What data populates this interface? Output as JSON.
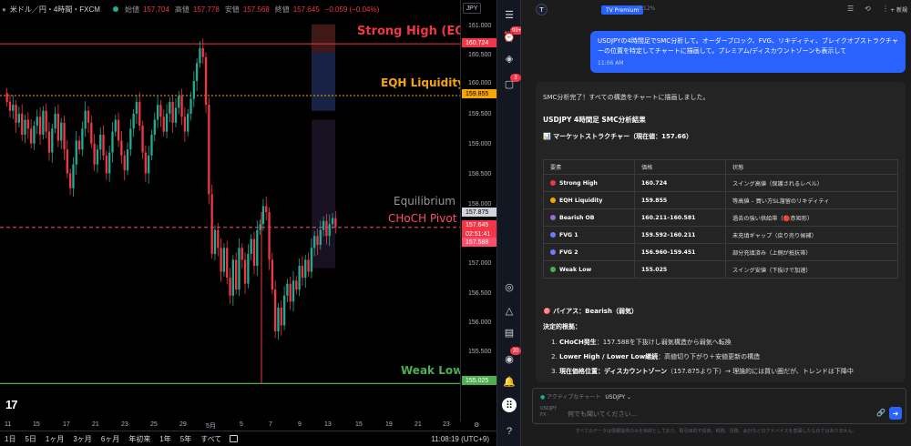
{
  "chart": {
    "symbol": "米ドル／円・4時間・FXCM",
    "ohlc": [
      {
        "label": "始値",
        "value": "157.704"
      },
      {
        "label": "高値",
        "value": "157.778"
      },
      {
        "label": "安値",
        "value": "157.568"
      },
      {
        "label": "終値",
        "value": "157.645"
      }
    ],
    "change": "−0.059 (−0.04%)",
    "currency": "JPY",
    "zones": {
      "strong_high": "Strong High (EQH)",
      "eqh_liquidity": "EQH Liquidity",
      "equilibrium": "Equilibrium",
      "choch_pivot": "CHoCH Pivot",
      "weak_low": "Weak Low"
    },
    "price_ticks": [
      "161.000",
      "160.500",
      "160.000",
      "159.500",
      "159.000",
      "158.500",
      "158.000",
      "157.000",
      "156.500",
      "156.000",
      "155.500"
    ],
    "price_tags": {
      "strong_high": "160.724",
      "eqh": "159.855",
      "equilibrium": "157.875",
      "current": "157.645",
      "countdown": "02:51:41",
      "choch": "157.588",
      "weak_low": "155.025"
    },
    "time_ticks": [
      "11",
      "15",
      "17",
      "21",
      "23",
      "25",
      "29",
      "5月",
      "5",
      "7",
      "9",
      "13",
      "15",
      "19",
      "21",
      "23"
    ],
    "colors": {
      "bull": "#22ab94",
      "bear": "#f23645",
      "strong_high": "#f23645",
      "eqh": "#f7a600",
      "equilibrium": "#9598a1",
      "choch": "#ff4d6d",
      "weak_low": "#4caf50"
    },
    "logo": "17"
  },
  "bottom_bar": {
    "timeframes": [
      "1日",
      "5日",
      "1ヶ月",
      "3ヶ月",
      "6ヶ月",
      "年初来",
      "1年",
      "5年",
      "すべて"
    ],
    "clock": "11:08:19 (UTC+9)"
  },
  "side_toolbar": {
    "badges": {
      "watchlist": "99+",
      "alerts": "3",
      "notifications": "30"
    }
  },
  "chat": {
    "avatar_letter": "T",
    "premium": "TV Premium",
    "usage": "12%",
    "new_chat": "+ 新規",
    "user_message": "USDJPYの4時間足でSMC分析して。オーダーブロック、FVG、リキディティ、ブレイクオブストラクチャーの位置を特定してチャートに描画して。プレミアム/ディスカウントゾーンも表示して",
    "user_time": "11:06 AM",
    "reply_intro": "SMC分析完了！すべての構造をチャートに描画しました。",
    "reply_title": "USDJPY 4時間足 SMC分析結果",
    "market_structure": "📊 マーケットストラクチャー（現在値：157.66）",
    "table": {
      "headers": [
        "要素",
        "価格",
        "状態"
      ],
      "rows": [
        {
          "name": "Strong High",
          "price": "160.724",
          "status": "スイング高値（保護されるレベル）",
          "color": "#f23645"
        },
        {
          "name": "EQH Liquidity",
          "price": "159.855",
          "status": "等高値 – 買い方SL溜留のリキディティ",
          "color": "#f7a600"
        },
        {
          "name": "Bearish OB",
          "price": "160.211–160.581",
          "status": "過去の強い供給帯（🔴赤矩形）",
          "color": "#9c6ade"
        },
        {
          "name": "FVG 1",
          "price": "159.592–160.211",
          "status": "未充填ギャップ（戻り売り候補）",
          "color": "#6b7cff"
        },
        {
          "name": "FVG 2",
          "price": "156.960–159.451",
          "status": "部分充填済み（上側が抵抗帯）",
          "color": "#6b7cff"
        },
        {
          "name": "Weak Low",
          "price": "155.025",
          "status": "スイング安値（下抜けで加速）",
          "color": "#4caf50"
        }
      ]
    },
    "bias": "🎯 バイアス：Bearish（弱気）",
    "evidence_title": "決定的根拠：",
    "evidence": [
      {
        "bold": "CHoCH発生",
        "text": "：157.588を下抜けし弱気構造から弱気へ転換"
      },
      {
        "bold": "Lower High / Lower Low継続",
        "text": "：高値切り下がり＋安値更新の構造"
      },
      {
        "bold": "現在価格位置：ディスカウントゾーン",
        "text": "（157.875より下）→ 理論的には買い圏だが、トレンドは下降中"
      }
    ],
    "active_chart_label": "アクティブなチャート",
    "active_chart_symbol": "USDJPY ⌄",
    "fx_label": "USDJPY",
    "fx_sub": "FX ·",
    "input_placeholder": "何でも聞いてください...",
    "disclaimer": "すべてのデータは情報提供のみを目的としており、取引目的や投資、税務、法務、会計などのアドバイスを意図したものではありません。"
  }
}
